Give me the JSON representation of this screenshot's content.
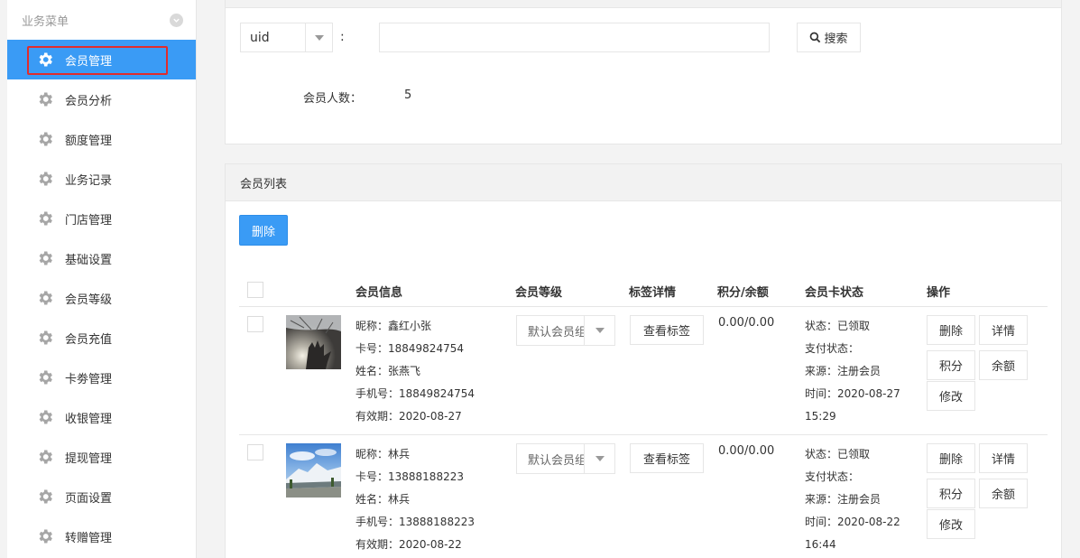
{
  "sidebar": {
    "title": "业务菜单",
    "items": [
      {
        "label": "会员管理"
      },
      {
        "label": "会员分析"
      },
      {
        "label": "额度管理"
      },
      {
        "label": "业务记录"
      },
      {
        "label": "门店管理"
      },
      {
        "label": "基础设置"
      },
      {
        "label": "会员等级"
      },
      {
        "label": "会员充值"
      },
      {
        "label": "卡劵管理"
      },
      {
        "label": "收银管理"
      },
      {
        "label": "提现管理"
      },
      {
        "label": "页面设置"
      },
      {
        "label": "转赠管理"
      }
    ]
  },
  "search": {
    "field_value": "uid",
    "colon": ":",
    "input_value": "",
    "button_label": "搜索",
    "count_label": "会员人数：",
    "count_value": "5"
  },
  "list": {
    "title": "会员列表",
    "delete_label": "删除",
    "columns": [
      "会员信息",
      "会员等级",
      "标签详情",
      "积分/余额",
      "会员卡状态",
      "操作"
    ],
    "rows": [
      {
        "nickname": "昵称：鑫红小张",
        "card": "卡号：18849824754",
        "name": "姓名：张燕飞",
        "phone": "手机号：18849824754",
        "expiry": "有效期：2020-08-27",
        "level": "默认会员组",
        "tag_button": "查看标签",
        "points": "0.00/0.00",
        "status": "状态：已领取",
        "pay_status": "支付状态：",
        "source": "来源：注册会员",
        "time": "时间：2020-08-27",
        "time2": "15:29",
        "ops": {
          "delete": "删除",
          "detail": "详情",
          "points": "积分",
          "balance": "余额",
          "edit": "修改"
        }
      },
      {
        "nickname": "昵称：林兵",
        "card": "卡号：13888188223",
        "name": "姓名：林兵",
        "phone": "手机号：13888188223",
        "expiry": "有效期：2020-08-22",
        "level": "默认会员组",
        "tag_button": "查看标签",
        "points": "0.00/0.00",
        "status": "状态：已领取",
        "pay_status": "支付状态：",
        "source": "来源：注册会员",
        "time": "时间：2020-08-22",
        "time2": "16:44",
        "ops": {
          "delete": "删除",
          "detail": "详情",
          "points": "积分",
          "balance": "余额",
          "edit": "修改"
        }
      }
    ]
  },
  "colors": {
    "accent": "#3a9bf5",
    "highlight_border": "#e12c2c"
  }
}
